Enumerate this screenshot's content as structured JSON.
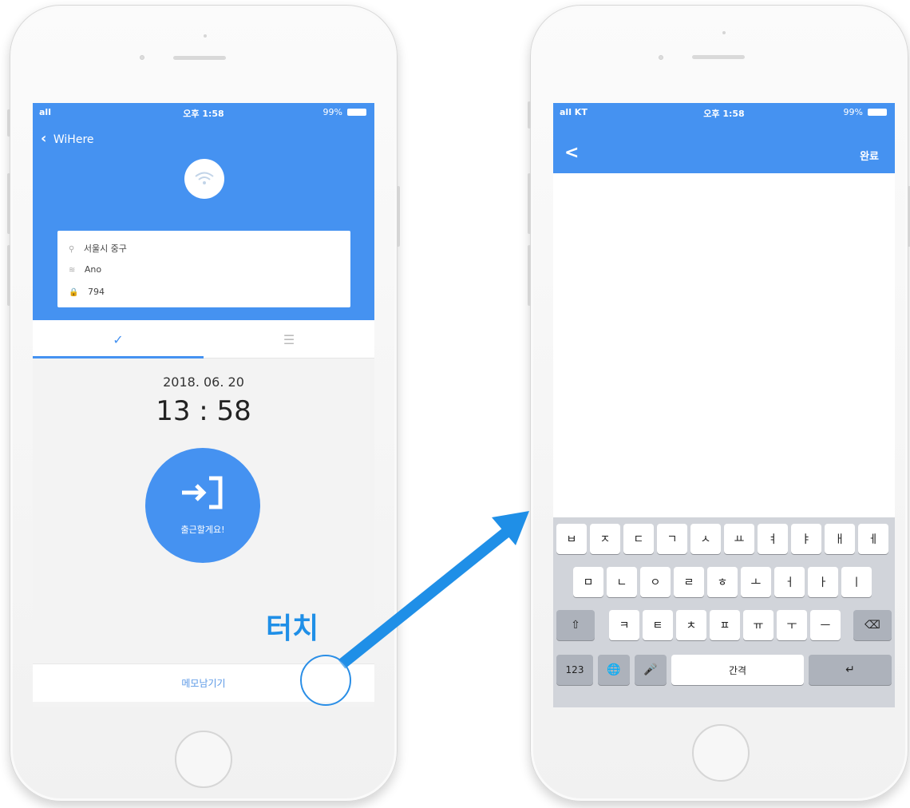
{
  "left_screen": {
    "status": {
      "signal": "all",
      "time": "오후 1:58",
      "battery": "99%"
    },
    "back_label": "WiHere",
    "info": [
      {
        "icon": "location-icon",
        "text": "서울시 중구"
      },
      {
        "icon": "wifi-icon",
        "text": "Ano"
      },
      {
        "icon": "lock-icon",
        "text": "794"
      }
    ],
    "tabs": [
      "✓",
      "☰"
    ],
    "date": "2018. 06. 20",
    "time": "13 : 58",
    "checkin_label": "출근할게요!",
    "memo_label": "메모남기기"
  },
  "annotation": {
    "touch_label": "터치",
    "accent": "#1f8fe7"
  },
  "right_screen": {
    "status": {
      "signal": "all KT",
      "time": "오후 1:58",
      "battery": "99%"
    },
    "back_icon": "<",
    "done_label": "완료",
    "keyboard": {
      "row1": [
        "ㅂ",
        "ㅈ",
        "ㄷ",
        "ㄱ",
        "ㅅ",
        "ㅛ",
        "ㅕ",
        "ㅑ",
        "ㅐ",
        "ㅔ"
      ],
      "row2": [
        "ㅁ",
        "ㄴ",
        "ㅇ",
        "ㄹ",
        "ㅎ",
        "ㅗ",
        "ㅓ",
        "ㅏ",
        "ㅣ"
      ],
      "row3": [
        "ㅋ",
        "ㅌ",
        "ㅊ",
        "ㅍ",
        "ㅠ",
        "ㅜ",
        "ㅡ"
      ],
      "shift": "⇧",
      "delete": "⌫",
      "numbers": "123",
      "globe": "🌐",
      "mic": "🎤",
      "space": "간격",
      "return": "↵"
    }
  },
  "colors": {
    "primary": "#4592f1",
    "keyboard_bg": "#d1d4da"
  }
}
